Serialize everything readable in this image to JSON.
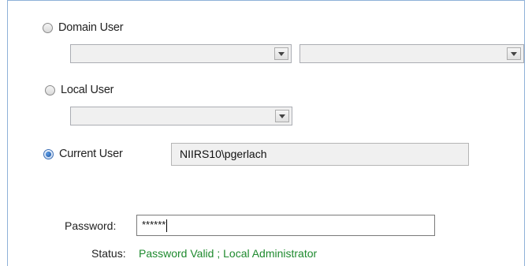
{
  "options": {
    "domain_user": {
      "label": "Domain User",
      "selected": false
    },
    "local_user": {
      "label": "Local User",
      "selected": false
    },
    "current_user": {
      "label": "Current User",
      "selected": true,
      "value": "NIIRS10\\pgerlach"
    }
  },
  "domain_combos": {
    "domain_value": "",
    "user_value": ""
  },
  "local_combo": {
    "value": ""
  },
  "password": {
    "label": "Password:",
    "value": "******"
  },
  "status": {
    "label": "Status:",
    "text": "Password Valid ; Local Administrator",
    "color": "#1e8a2e"
  },
  "icons": {
    "dropdown": "chevron-down-icon"
  }
}
